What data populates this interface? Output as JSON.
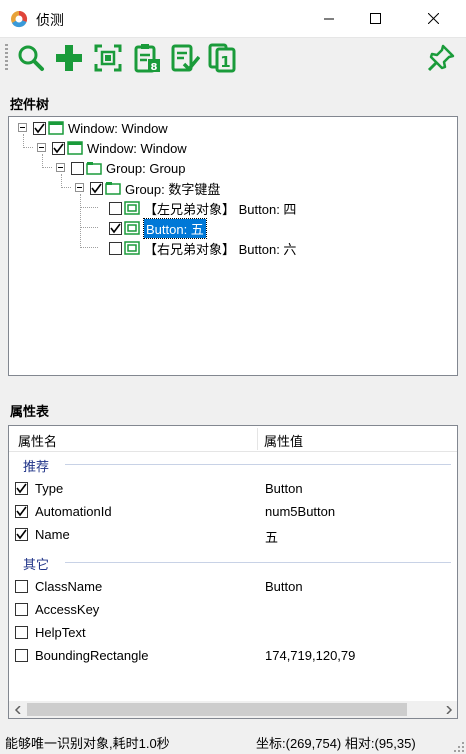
{
  "window": {
    "title": "侦测",
    "icon": "app-logo-icon",
    "controls": [
      "minimize-icon",
      "maximize-icon",
      "close-icon"
    ]
  },
  "toolbar": {
    "buttons": [
      "search-icon",
      "add-icon",
      "capture-icon",
      "copy-code-icon",
      "verify-icon",
      "copy-one-icon"
    ],
    "pin_icon": "pin-icon",
    "accent_color": "#1a9b3a"
  },
  "tree": {
    "title": "控件树",
    "nodes": [
      {
        "label": "Window: Window",
        "checked": true
      },
      {
        "label": "Window: Window",
        "checked": true
      },
      {
        "label": "Group: Group",
        "checked": false
      },
      {
        "label": "Group: 数字键盘",
        "checked": true
      },
      {
        "label": "【左兄弟对象】 Button: 四",
        "checked": false
      },
      {
        "label": "Button: 五",
        "checked": true,
        "selected": true
      },
      {
        "label": "【右兄弟对象】 Button: 六",
        "checked": false
      }
    ]
  },
  "properties": {
    "title": "属性表",
    "col_name": "属性名",
    "col_value": "属性值",
    "groups": [
      {
        "name": "推荐",
        "rows": [
          {
            "name": "Type",
            "value": "Button",
            "checked": true
          },
          {
            "name": "AutomationId",
            "value": "num5Button",
            "checked": true
          },
          {
            "name": "Name",
            "value": "五",
            "checked": true
          }
        ]
      },
      {
        "name": "其它",
        "rows": [
          {
            "name": "ClassName",
            "value": "Button",
            "checked": false
          },
          {
            "name": "AccessKey",
            "value": "",
            "checked": false
          },
          {
            "name": "HelpText",
            "value": "",
            "checked": false
          },
          {
            "name": "BoundingRectangle",
            "value": "174,719,120,79",
            "checked": false
          }
        ]
      }
    ]
  },
  "status": {
    "message": "能够唯一识别对象,耗时1.0秒",
    "coords": "坐标:(269,754) 相对:(95,35)"
  }
}
